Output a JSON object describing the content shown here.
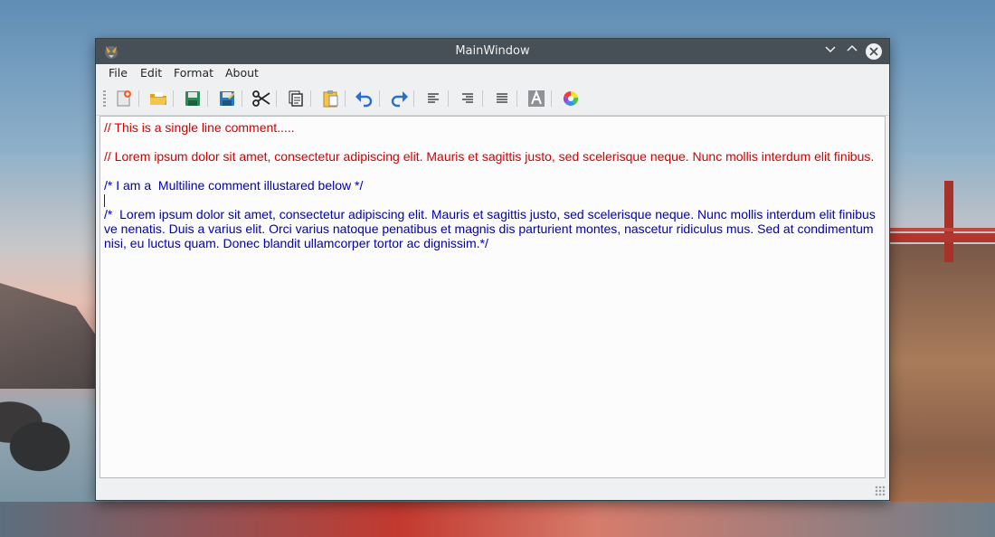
{
  "window": {
    "title": "MainWindow"
  },
  "menubar": {
    "items": [
      "File",
      "Edit",
      "Format",
      "About"
    ]
  },
  "toolbar": {
    "tools": [
      "new-file-icon",
      "open-folder-icon",
      "save-icon",
      "save-as-icon",
      "cut-icon",
      "copy-icon",
      "paste-icon",
      "undo-icon",
      "redo-icon",
      "align-left-icon",
      "align-right-icon",
      "justify-icon",
      "font-icon",
      "color-picker-icon"
    ]
  },
  "editor": {
    "lines": [
      {
        "text": "// This is a single line comment.....",
        "color": "#d40000"
      },
      {
        "text": "",
        "color": "#d40000"
      },
      {
        "text": "// Lorem ipsum dolor sit amet, consectetur adipiscing elit. Mauris et sagittis justo, sed scelerisque neque. Nunc mollis interdum elit finibus.",
        "color": "#d40000"
      },
      {
        "text": "",
        "color": "#0000b4"
      },
      {
        "text": "/* I am a  Multiline comment illustared below */",
        "color": "#0000b4"
      },
      {
        "text": "",
        "color": "#0000b4"
      },
      {
        "text": "/*  Lorem ipsum dolor sit amet, consectetur adipiscing elit. Mauris et sagittis justo, sed scelerisque neque. Nunc mollis interdum elit finibus ve nenatis. Duis a varius elit. Orci varius natoque penatibus et magnis dis parturient montes, nascetur ridiculus mus. Sed at condimentum nisi, eu luctus quam. Donec blandit ullamcorper tortor ac dignissim.*/",
        "color": "#0000b4"
      }
    ]
  },
  "colors": {
    "titlebar": "#475057",
    "comment_single": "#d40000",
    "comment_multi": "#0000b4"
  }
}
